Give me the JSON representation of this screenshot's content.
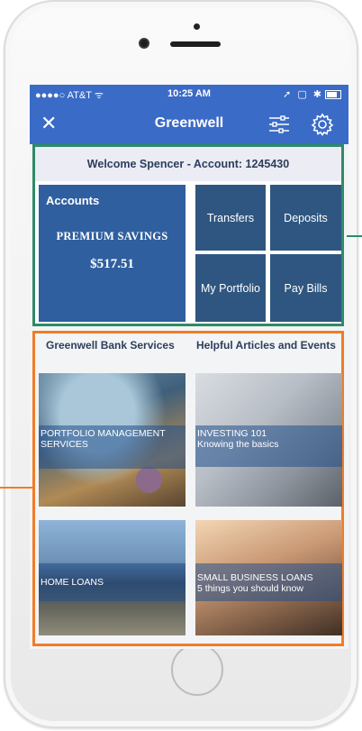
{
  "status_bar": {
    "carrier": "●●●●○ AT&T ᯤ",
    "time": "10:25 AM",
    "icons": "➚ ▢ ✱"
  },
  "nav": {
    "close_icon": "✕",
    "title": "Greenwell",
    "filter_icon": "sliders-icon",
    "settings_icon": "gear-icon"
  },
  "welcome": "Welcome Spencer - Account: 1245430",
  "accounts": {
    "label": "Accounts",
    "type": "PREMIUM SAVINGS",
    "amount": "$517.51"
  },
  "tiles": {
    "transfers": "Transfers",
    "deposits": "Deposits",
    "portfolio": "My Portfolio",
    "paybills": "Pay Bills"
  },
  "sections": {
    "left": "Greenwell Bank Services",
    "right": "Helpful Articles and Events"
  },
  "cards": {
    "portfolio": "PORTFOLIO MANAGEMENT SERVICES",
    "investing_title": "INVESTING 101",
    "investing_sub": "Knowing the basics",
    "home": "HOME LOANS",
    "business_title": "SMALL BUSINESS LOANS",
    "business_sub": "5 things you should know"
  },
  "colors": {
    "brand_blue": "#3a6bc7",
    "highlight_green": "#2e8b67",
    "highlight_orange": "#f07c28"
  }
}
